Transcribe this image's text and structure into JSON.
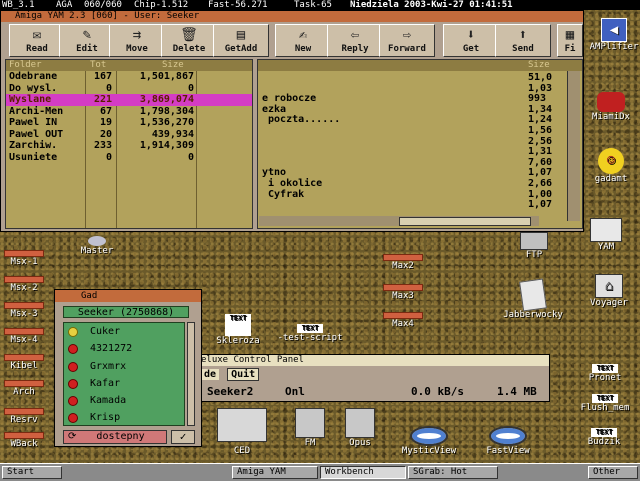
{
  "screen_bar": {
    "items": [
      "WB_3.1",
      "AGA",
      "060/060",
      "Chip-1.512",
      "Fast-56.271",
      "Task-65",
      "Niedziela 2003-Kwi-27 01:41:51"
    ]
  },
  "yam": {
    "title": "Amiga YAM 2.3 [060]  -  User: Seeker",
    "toolbar": [
      {
        "label": "Read",
        "icon": "read-icon"
      },
      {
        "label": "Edit",
        "icon": "edit-icon"
      },
      {
        "label": "Move",
        "icon": "move-icon"
      },
      {
        "label": "Delete",
        "icon": "delete-icon"
      },
      {
        "label": "GetAdd",
        "icon": "getadd-icon"
      },
      {
        "label": "New",
        "icon": "new-icon"
      },
      {
        "label": "Reply",
        "icon": "reply-icon"
      },
      {
        "label": "Forward",
        "icon": "forward-icon"
      },
      {
        "label": "Get",
        "icon": "get-icon"
      },
      {
        "label": "Send",
        "icon": "send-icon"
      },
      {
        "label": "Fi",
        "icon": "filter-icon"
      }
    ],
    "folder_headers": [
      "Folder",
      "Tot",
      "Size"
    ],
    "folders": [
      {
        "name": "Odebrane",
        "total": "167",
        "size": "1,501,867",
        "selected": false
      },
      {
        "name": "Do wysl.",
        "total": "0",
        "size": "0",
        "selected": false
      },
      {
        "name": "Wyslane",
        "total": "221",
        "size": "3,869,074",
        "selected": true
      },
      {
        "name": "Archi-Men",
        "total": "67",
        "size": "1,798,304",
        "selected": false
      },
      {
        "name": "Pawel IN",
        "total": "19",
        "size": "1,536,270",
        "selected": false
      },
      {
        "name": "Pawel OUT",
        "total": "20",
        "size": "439,934",
        "selected": false
      },
      {
        "name": "Zarchiw.",
        "total": "233",
        "size": "1,914,309",
        "selected": false
      },
      {
        "name": "Usuniete",
        "total": "0",
        "size": "0",
        "selected": false
      }
    ],
    "message_size_header": "Size",
    "messages": [
      {
        "text": "",
        "size": "51,0"
      },
      {
        "text": "",
        "size": "1,03"
      },
      {
        "text": "e robocze",
        "size": "993"
      },
      {
        "text": "ezka",
        "size": "1,34"
      },
      {
        "text": " poczta......",
        "size": "1,24"
      },
      {
        "text": "",
        "size": "1,56"
      },
      {
        "text": "",
        "size": "2,56"
      },
      {
        "text": "",
        "size": "1,31"
      },
      {
        "text": "",
        "size": "7,60"
      },
      {
        "text": "ytno",
        "size": "1,07"
      },
      {
        "text": " i okolice",
        "size": "2,66"
      },
      {
        "text": " Cyfrak",
        "size": "1,00"
      },
      {
        "text": "",
        "size": "1,07"
      }
    ]
  },
  "right_icons": [
    {
      "label": "AMPlifier",
      "icon": "speaker-icon"
    },
    {
      "label": "MiamiDx",
      "icon": "phone-icon"
    },
    {
      "label": "gadamt",
      "icon": "smiley-icon"
    },
    {
      "label": "YAM",
      "icon": "yam-icon"
    },
    {
      "label": "FTP",
      "icon": "ftp-icon"
    },
    {
      "label": "Voyager",
      "icon": "house-icon"
    },
    {
      "label": "Pronet",
      "icon": "text-icon"
    },
    {
      "label": "Flush_mem",
      "icon": "text-icon"
    },
    {
      "label": "Budzik",
      "icon": "text-icon"
    }
  ],
  "left_buttons": [
    "Msx-1",
    "Msx-2",
    "Msx-3",
    "Msx-4",
    "Kibel",
    "Arch",
    "Resrv",
    "WBack"
  ],
  "mid_icons": [
    {
      "label": "Master",
      "icon": "disk-icon"
    },
    {
      "label": "Max2",
      "icon": "bar-icon"
    },
    {
      "label": "Max3",
      "icon": "bar-icon"
    },
    {
      "label": "Max4",
      "icon": "bar-icon"
    },
    {
      "label": "Jabberwocky",
      "icon": "doc-icon"
    },
    {
      "label": "Skleroza",
      "icon": "text-icon"
    },
    {
      "label": "-test-script",
      "icon": "text-icon"
    },
    {
      "label": "CED",
      "icon": "ced-icon"
    },
    {
      "label": "FM",
      "icon": "fm-icon"
    },
    {
      "label": "Opus",
      "icon": "opus-icon"
    },
    {
      "label": "MysticView",
      "icon": "eye-icon"
    },
    {
      "label": "FastView",
      "icon": "eye-icon"
    }
  ],
  "gad": {
    "title": "Gad",
    "user": "Seeker (2750868)",
    "contacts": [
      "Cuker",
      "4321272",
      "Grxmrx",
      "Kafar",
      "Kamada",
      "Krisp"
    ],
    "status": "dostepny",
    "ok": "✓"
  },
  "control_panel": {
    "title": "eluxe Control Panel",
    "menu": [
      "de",
      "Quit"
    ],
    "row": {
      "name": "Seeker2",
      "status": "Onl",
      "speed": "0.0 kB/s",
      "size": "1.4 MB"
    }
  },
  "taskbar": [
    "Start",
    "Amiga YAM",
    "Workbench",
    "SGrab: Hot",
    "Other"
  ]
}
